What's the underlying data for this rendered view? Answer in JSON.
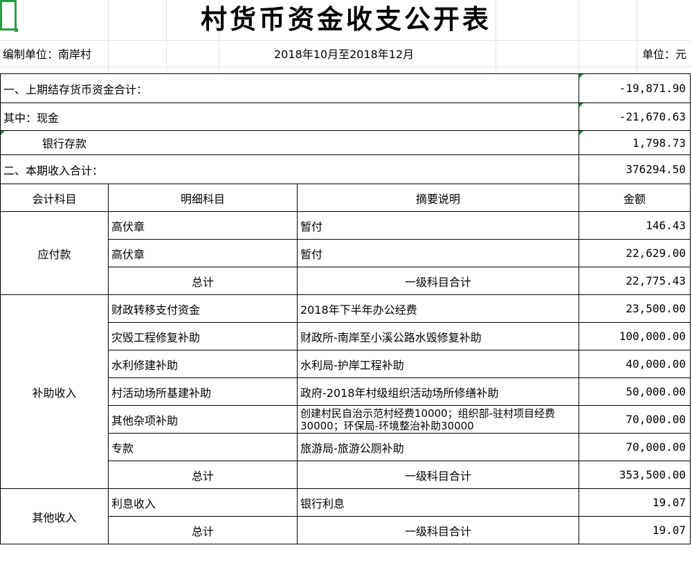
{
  "title": "村货币资金收支公开表",
  "header": {
    "unit_label": "编制单位：南岸村",
    "period": "2018年10月至2018年12月",
    "currency_label": "单位：元"
  },
  "summary": {
    "prev_balance_label": "一、上期结存货币资金合计：",
    "prev_balance_value": "-19,871.90",
    "cash_label": "其中：现金",
    "cash_value": "-21,670.63",
    "bank_label": "银行存款",
    "bank_value": "1,798.73",
    "income_total_label": "二、本期收入合计：",
    "income_total_value": "376294.50"
  },
  "columns": [
    "会计科目",
    "明细科目",
    "摘要说明",
    "金额"
  ],
  "groups": [
    {
      "subject": "应付款",
      "rows": [
        {
          "detail": "高伏章",
          "desc": "暂付",
          "amount": "146.43"
        },
        {
          "detail": "高伏章",
          "desc": "暂付",
          "amount": "22,629.00"
        }
      ],
      "total": {
        "label": "总计",
        "desc": "一级科目合计",
        "amount": "22,775.43"
      }
    },
    {
      "subject": "补助收入",
      "rows": [
        {
          "detail": "财政转移支付资金",
          "desc": "2018年下半年办公经费",
          "amount": "23,500.00"
        },
        {
          "detail": "灾毁工程修复补助",
          "desc": "财政所-南岸至小溪公路水毁修复补助",
          "amount": "100,000.00"
        },
        {
          "detail": "水利修建补助",
          "desc": "水利局-护岸工程补助",
          "amount": "40,000.00"
        },
        {
          "detail": "村活动场所基建补助",
          "desc": "政府-2018年村级组织活动场所修缮补助",
          "amount": "50,000.00"
        },
        {
          "detail": "其他杂项补助",
          "desc": "创建村民自治示范村经费10000；组织部-驻村项目经费30000；环保局-环境整治补助30000",
          "amount": "70,000.00"
        },
        {
          "detail": "专款",
          "desc": "旅游局-旅游公厕补助",
          "amount": "70,000.00"
        }
      ],
      "total": {
        "label": "总计",
        "desc": "一级科目合计",
        "amount": "353,500.00"
      }
    },
    {
      "subject": "其他收入",
      "rows": [
        {
          "detail": "利息收入",
          "desc": "银行利息",
          "amount": "19.07"
        }
      ],
      "total": {
        "label": "总计",
        "desc": "一级科目合计",
        "amount": "19.07"
      }
    }
  ]
}
